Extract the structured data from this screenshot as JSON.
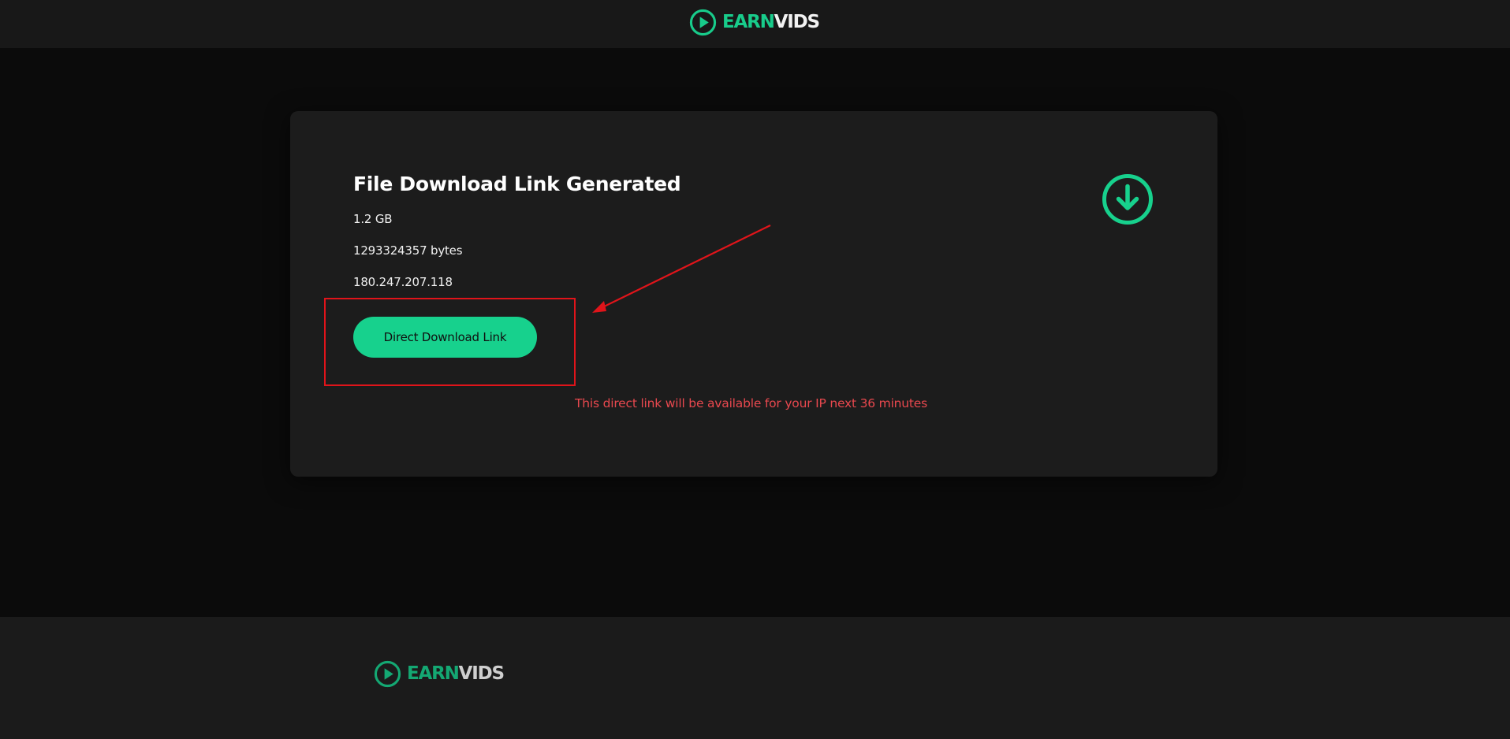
{
  "header": {
    "logo": {
      "icon": "play-circle-icon",
      "word_earn": "EARN",
      "word_vids": "VIDS"
    }
  },
  "card": {
    "title": "File Download Link Generated",
    "file_size": "1.2 GB",
    "file_bytes": "1293324357 bytes",
    "ip_address": "180.247.207.118",
    "download_button_label": "Direct Download Link",
    "notice": "This direct link will be available for your IP next 36 minutes",
    "icon": "download-circle-icon"
  },
  "footer": {
    "logo": {
      "icon": "play-circle-icon",
      "word_earn": "EARN",
      "word_vids": "VIDS"
    }
  },
  "colors": {
    "accent": "#17d18d",
    "background": "#0b0b0b",
    "card_background": "#1c1c1c",
    "notice_text": "#e8484e",
    "annotation": "#e0141a"
  }
}
